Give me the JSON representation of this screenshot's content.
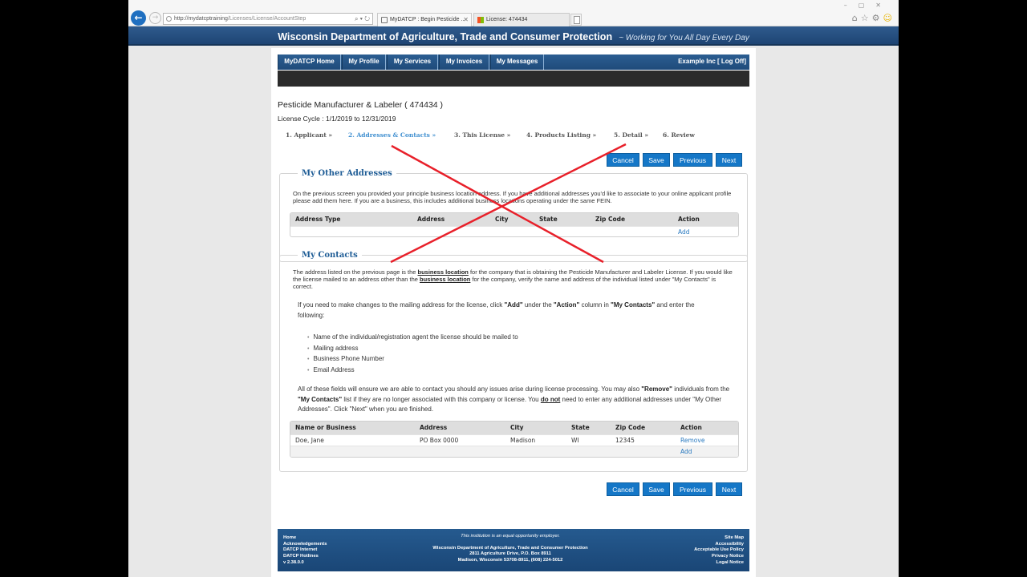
{
  "browser": {
    "url": "http://mydatcptraining/Licenses/License/AccountStep",
    "url_host": "http://mydatcptraining",
    "url_path": "/Licenses/License/AccountStep",
    "tabs": [
      {
        "title": "MyDATCP : Begin Pesticide ...",
        "active": true
      },
      {
        "title": "License: 474434",
        "active": false
      }
    ],
    "icons": [
      "back-icon",
      "forward-icon",
      "search-icon",
      "refresh-icon",
      "home-icon",
      "favorites-star-icon",
      "settings-gear-icon",
      "feedback-smiley-icon"
    ]
  },
  "header": {
    "title": "Wisconsin Department of Agriculture, Trade and Consumer Protection",
    "tagline": "~ Working for You All Day Every Day"
  },
  "nav": {
    "items": [
      "MyDATCP Home",
      "My Profile",
      "My Services",
      "My Invoices",
      "My Messages"
    ],
    "account": "Example Inc [ Log Off]"
  },
  "license": {
    "title": "Pesticide Manufacturer & Labeler ( 474434 )",
    "cycle": "License Cycle : 1/1/2019 to 12/31/2019"
  },
  "steps": [
    "1. Applicant »",
    "2. Addresses & Contacts »",
    "3. This License »",
    "4. Products Listing »",
    "5. Detail »",
    "6. Review"
  ],
  "active_step": 2,
  "buttons": {
    "cancel": "Cancel",
    "save": "Save",
    "previous": "Previous",
    "next": "Next"
  },
  "other_addresses": {
    "legend": "My Other Addresses",
    "text": "On the previous screen you provided your principle business location address. If you have additional addresses you'd like to associate to your online applicant profile please add them here. If you are a business, this includes additional business locations operating under the same FEIN.",
    "columns": [
      "Address Type",
      "Address",
      "City",
      "State",
      "Zip Code",
      "Action"
    ],
    "add_label": "Add"
  },
  "contacts": {
    "legend": "My Contacts",
    "p1_a": "The address listed on the previous page is the ",
    "p1_b": "business location",
    "p1_c": " for the company that is obtaining the Pesticide Manufacturer and Labeler License. If you would like the license mailed to an address other than the ",
    "p1_d": "business location",
    "p1_e": " for the company, verify the name and address of the individual listed under \"My Contacts\" is correct.",
    "p2_a": "If you need to make changes to the mailing address for the license, click ",
    "p2_b": "\"Add\"",
    "p2_c": " under the ",
    "p2_d": "\"Action\"",
    "p2_e": " column in ",
    "p2_f": "\"My Contacts\"",
    "p2_g": " and enter the following:",
    "list": [
      "Name of the individual/registration agent the license should be mailed to",
      "Mailing address",
      "Business Phone Number",
      "Email Address"
    ],
    "p3_a": "All of these fields will ensure we are able to contact you should any issues arise during license processing. You may also ",
    "p3_b": "\"Remove\"",
    "p3_c": " individuals from the ",
    "p3_d": "\"My Contacts\"",
    "p3_e": " list if they are no longer associated with this company or license. You ",
    "p3_f": "do not",
    "p3_g": " need to enter any additional addresses under \"My Other Addresses\". Click \"Next\" when you are finished.",
    "columns": [
      "Name or Business",
      "Address",
      "City",
      "State",
      "Zip Code",
      "Action"
    ],
    "rows": [
      {
        "name": "Doe, Jane",
        "address": "PO Box 0000",
        "city": "Madison",
        "state": "WI",
        "zip": "12345",
        "action": "Remove"
      }
    ],
    "add_label": "Add"
  },
  "overlay": {
    "mark": "red-x",
    "color": "#e8202a"
  },
  "footer": {
    "left": [
      "Home",
      "Acknowledgements",
      "DATCP Internet",
      "DATCP Hotlines",
      "v 2.38.0.0"
    ],
    "eeo": "This institution is an equal opportunity employer.",
    "center": [
      "Wisconsin Department of Agriculture, Trade and Consumer Protection",
      "2811 Agriculture Drive, P.O. Box 8911",
      "Madison, Wisconsin 53708-8911, (608) 224-5012"
    ],
    "right": [
      "Site Map",
      "Accessibility",
      "Acceptable Use Policy",
      "Privacy Notice",
      "Legal Notice"
    ]
  },
  "colors": {
    "brand_blue": "#1f4b7a",
    "button_blue": "#1577c7",
    "link_blue": "#2a7ac0",
    "active_step": "#3f8fd0"
  }
}
